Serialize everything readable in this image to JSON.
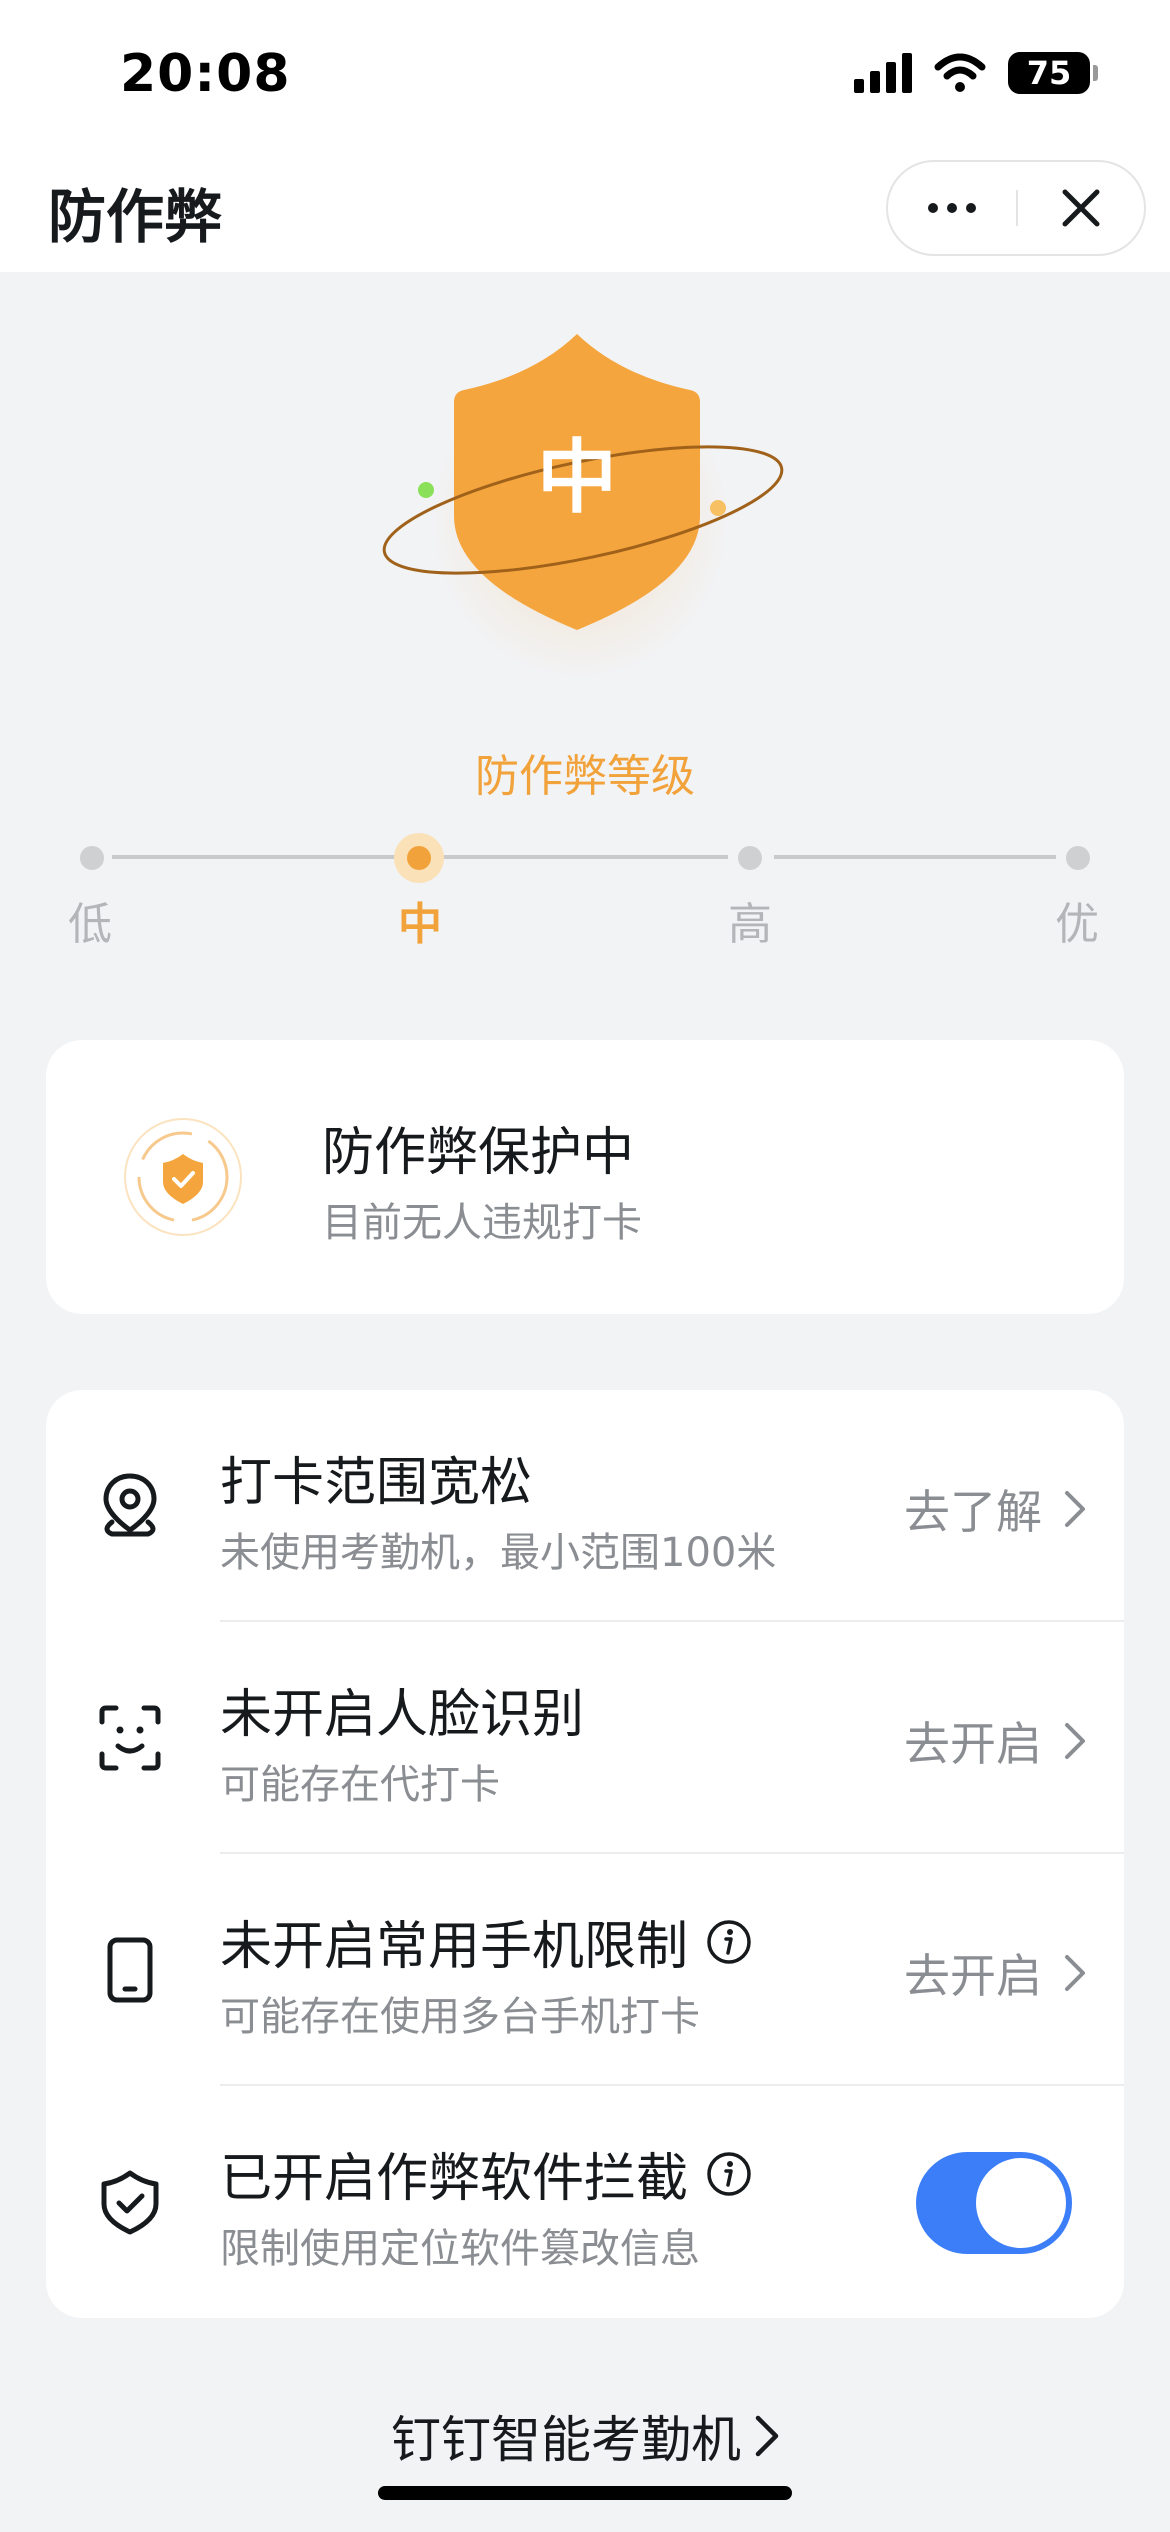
{
  "status_bar": {
    "time": "20:08",
    "battery": "75"
  },
  "nav": {
    "title": "防作弊"
  },
  "hero": {
    "shield_label": "中",
    "level_title": "防作弊等级"
  },
  "levels": [
    {
      "label": "低",
      "active": false
    },
    {
      "label": "中",
      "active": true
    },
    {
      "label": "高",
      "active": false
    },
    {
      "label": "优",
      "active": false
    }
  ],
  "status_card": {
    "title": "防作弊保护中",
    "subtitle": "目前无人违规打卡"
  },
  "items": [
    {
      "title": "打卡范围宽松",
      "subtitle": "未使用考勤机，最小范围100米",
      "action": "去了解",
      "icon": "location-pin-icon",
      "info": false
    },
    {
      "title": "未开启人脸识别",
      "subtitle": "可能存在代打卡",
      "action": "去开启",
      "icon": "face-scan-icon",
      "info": false
    },
    {
      "title": "未开启常用手机限制",
      "subtitle": "可能存在使用多台手机打卡",
      "action": "去开启",
      "icon": "phone-icon",
      "info": true
    },
    {
      "title": "已开启作弊软件拦截",
      "subtitle": "限制使用定位软件篡改信息",
      "toggle_on": true,
      "icon": "shield-check-icon",
      "info": true
    }
  ],
  "footer": {
    "link": "钉钉智能考勤机"
  },
  "colors": {
    "accent": "#f2a23a",
    "toggle": "#3b7ef8",
    "text": "#171a1d",
    "muted": "#8a8d92",
    "background": "#f2f3f5"
  }
}
